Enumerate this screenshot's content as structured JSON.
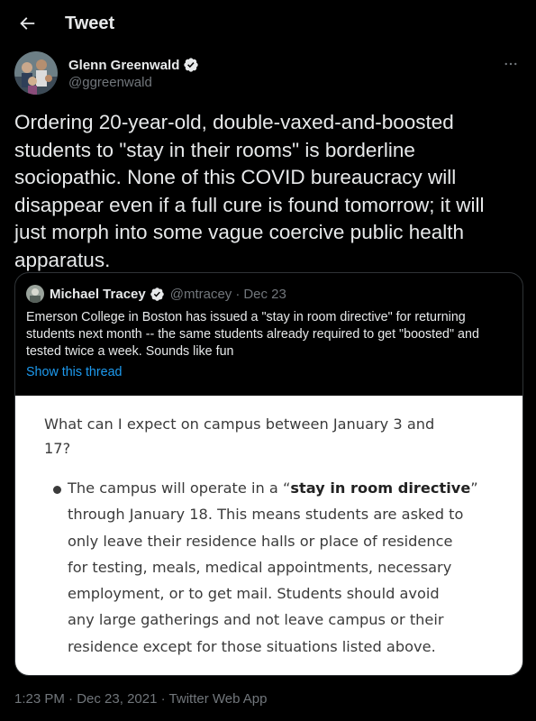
{
  "header": {
    "title": "Tweet"
  },
  "author": {
    "name": "Glenn Greenwald",
    "handle": "@ggreenwald"
  },
  "tweet": {
    "text": "Ordering 20-year-old, double-vaxed-and-boosted\nstudents to \"stay in their rooms\" is borderline\nsociopathic. None of this COVID bureaucracy will\ndisappear even if a full cure is found tomorrow; it will\njust morph into some vague coercive public health\napparatus."
  },
  "quote": {
    "name": "Michael Tracey",
    "handle": "@mtracey",
    "separator": "·",
    "date": "Dec 23",
    "text": "Emerson College in Boston has issued a \"stay in room directive\" for returning\nstudents next month -- the same students already required to get \"boosted\" and\ntested twice a week. Sounds like fun",
    "show_thread": "Show this thread",
    "image": {
      "question": "What can I expect on campus between January 3 and\n17?",
      "body_prefix": "The campus will operate in a “",
      "body_bold": "stay in room directive",
      "body_suffix": "”\nthrough January 18. This means students are asked to\nonly leave their residence halls or place of residence\nfor testing, meals, medical appointments, necessary\nemployment, or to get mail.  Students should avoid\nany large gatherings and not leave campus or their\nresidence except for those situations listed above."
    }
  },
  "meta": {
    "time": "1:23 PM",
    "separator1": "·",
    "date": "Dec 23, 2021",
    "separator2": "·",
    "client": "Twitter Web App"
  },
  "icons": {
    "back": "arrow-left-icon",
    "verified": "verified-badge-icon",
    "more": "more-icon"
  },
  "colors": {
    "background": "#000000",
    "text": "#e7e9ea",
    "muted": "#71767b",
    "link": "#1d9bf0",
    "border": "#2f3336"
  }
}
